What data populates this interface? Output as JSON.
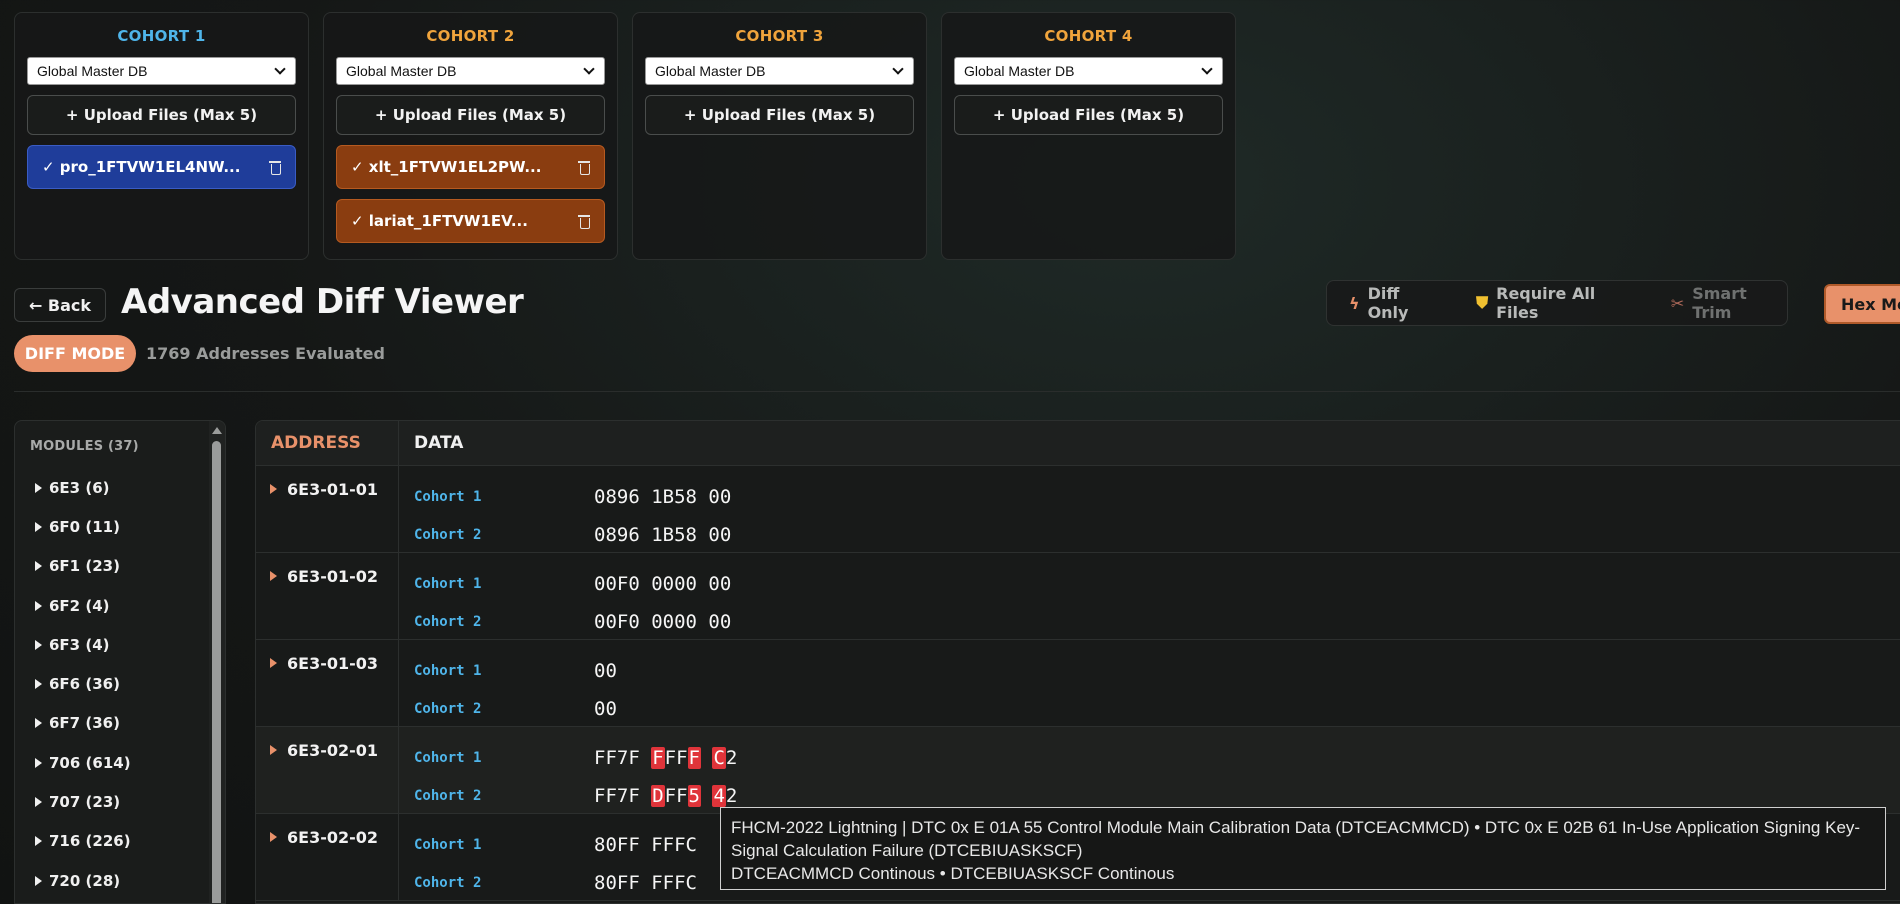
{
  "cohorts": [
    {
      "title": "COHORT 1",
      "db": "Global Master DB",
      "upload_label": "+ Upload Files (Max 5)",
      "files": [
        "✓ pro_1FTVW1EL4NW..."
      ]
    },
    {
      "title": "COHORT 2",
      "db": "Global Master DB",
      "upload_label": "+ Upload Files (Max 5)",
      "files": [
        "✓ xlt_1FTVW1EL2PW...",
        "✓ lariat_1FTVW1EV..."
      ]
    },
    {
      "title": "COHORT 3",
      "db": "Global Master DB",
      "upload_label": "+ Upload Files (Max 5)",
      "files": []
    },
    {
      "title": "COHORT 4",
      "db": "Global Master DB",
      "upload_label": "+ Upload Files (Max 5)",
      "files": []
    }
  ],
  "colors": {
    "cohort1": "#4fb5ea",
    "cohort_other": "#f0a43c",
    "accent": "#e8916a",
    "diff_highlight": "#e0343a"
  },
  "header": {
    "back_label": "← Back",
    "title": "Advanced Diff Viewer",
    "mode_badge": "DIFF MODE",
    "evaluated": "1769 Addresses Evaluated"
  },
  "toolbar": {
    "diff_only": "Diff Only",
    "require_all": "Require All Files",
    "smart_trim": "Smart Trim",
    "hex_mode": "Hex Mode"
  },
  "sidebar": {
    "heading": "MODULES (37)",
    "items": [
      "6E3 (6)",
      "6F0 (11)",
      "6F1 (23)",
      "6F2 (4)",
      "6F3 (4)",
      "6F6 (36)",
      "6F7 (36)",
      "706 (614)",
      "707 (23)",
      "716 (226)",
      "720 (28)"
    ]
  },
  "table": {
    "col_address": "ADDRESS",
    "col_data": "DATA",
    "rows": [
      {
        "address": "6E3-01-01",
        "lines": [
          {
            "label": "Cohort 1",
            "value": "0896 1B58 00"
          },
          {
            "label": "Cohort 2",
            "value": "0896 1B58 00"
          }
        ]
      },
      {
        "address": "6E3-01-02",
        "lines": [
          {
            "label": "Cohort 1",
            "value": "00F0 0000 00"
          },
          {
            "label": "Cohort 2",
            "value": "00F0 0000 00"
          }
        ]
      },
      {
        "address": "6E3-01-03",
        "lines": [
          {
            "label": "Cohort 1",
            "value": "00"
          },
          {
            "label": "Cohort 2",
            "value": "00"
          }
        ]
      },
      {
        "address": "6E3-02-01",
        "lines": [
          {
            "label": "Cohort 1",
            "value": "FF7F FFFF C2",
            "segments": [
              [
                "FF7F ",
                false
              ],
              [
                "F",
                true
              ],
              [
                "FF",
                false
              ],
              [
                "F",
                true
              ],
              [
                " ",
                false
              ],
              [
                "C",
                true
              ],
              [
                "2",
                false
              ]
            ]
          },
          {
            "label": "Cohort 2",
            "value": "FF7F DFF5 42",
            "segments": [
              [
                "FF7F ",
                false
              ],
              [
                "D",
                true
              ],
              [
                "FF",
                false
              ],
              [
                "5",
                true
              ],
              [
                " ",
                false
              ],
              [
                "4",
                true
              ],
              [
                "2",
                false
              ]
            ]
          }
        ]
      },
      {
        "address": "6E3-02-02",
        "lines": [
          {
            "label": "Cohort 1",
            "value": "80FF FFFC"
          },
          {
            "label": "Cohort 2",
            "value": "80FF FFFC"
          }
        ]
      }
    ]
  },
  "tooltip": {
    "line1": "FHCM-2022 Lightning | DTC 0x E 01A 55 Control Module Main Calibration Data (DTCEACMMCD) • DTC 0x E 02B 61 In-Use Application Signing Key-Signal Calculation Failure (DTCEBIUASKSCF)",
    "line2": "DTCEACMMCD Continous • DTCEBIUASKSCF Continous"
  }
}
